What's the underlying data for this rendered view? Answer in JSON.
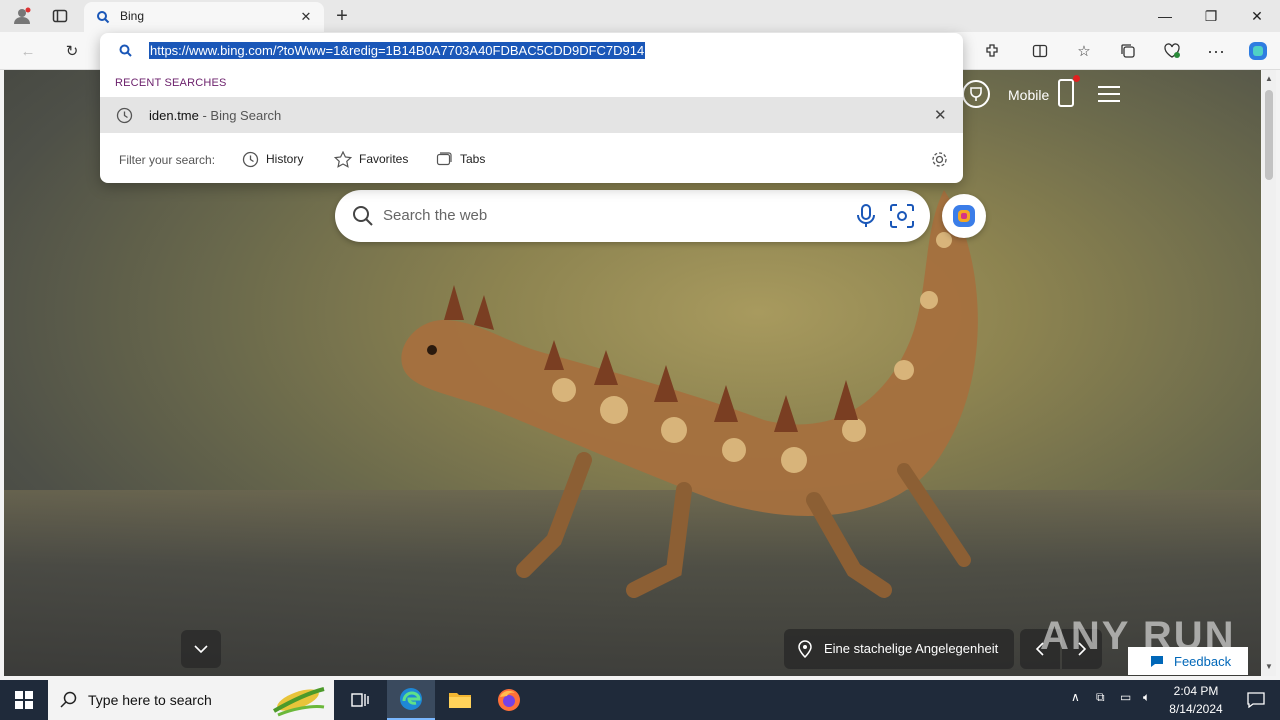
{
  "browser": {
    "tab_title": "Bing",
    "address_url": "https://www.bing.com/?toWww=1&redig=1B14B0A7703A40FDBAC5CDD9DFC7D914"
  },
  "omnibox_dropdown": {
    "recent_label": "RECENT SEARCHES",
    "suggestion_query": "iden.tme",
    "suggestion_suffix": " - Bing Search",
    "filter_label": "Filter your search:",
    "filters": [
      "History",
      "Favorites",
      "Tabs"
    ]
  },
  "bing": {
    "mobile_label": "Mobile",
    "search_placeholder": "Search the web",
    "image_caption": "Eine stachelige Angelegenheit",
    "feedback_label": "Feedback",
    "watermark": "ANY RUN"
  },
  "taskbar": {
    "search_placeholder": "Type here to search",
    "time": "2:04 PM",
    "date": "8/14/2024"
  },
  "colors": {
    "accent": "#1a57b8",
    "bing_blue": "#0067b8",
    "taskbar": "#1f2a3a"
  }
}
